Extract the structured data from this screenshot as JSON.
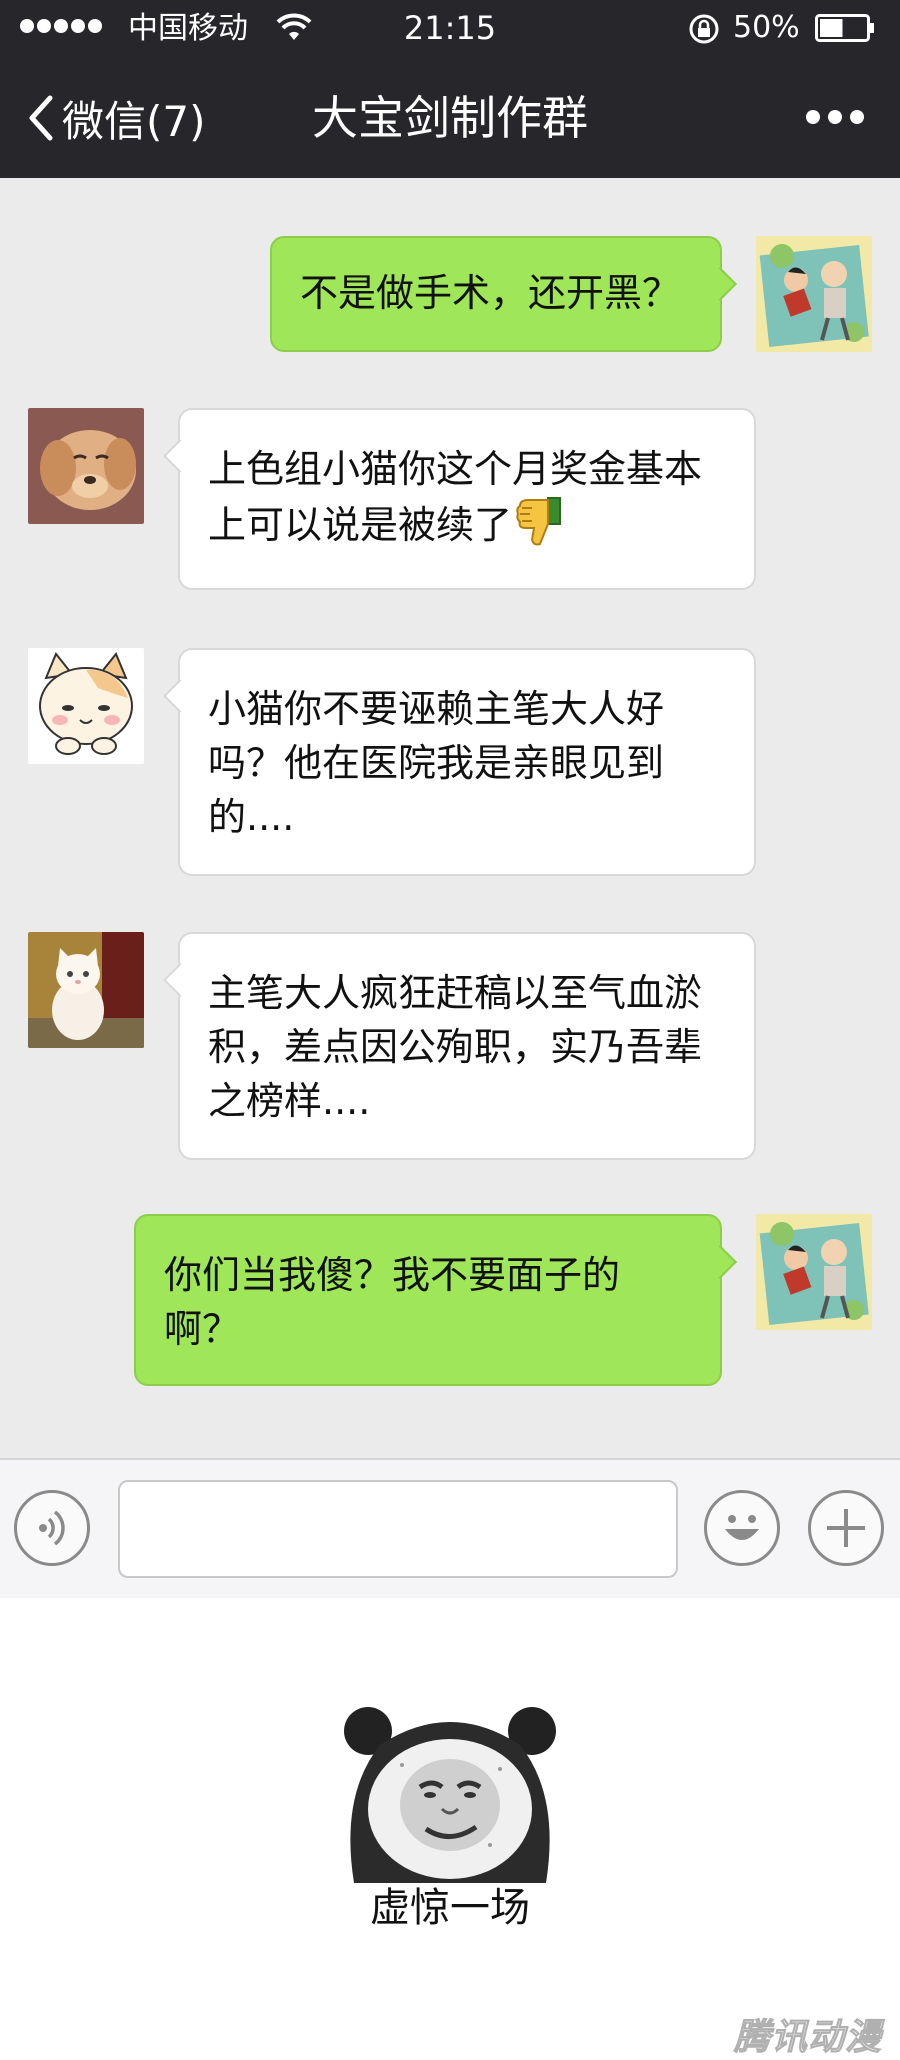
{
  "status_bar": {
    "carrier": "中国移动",
    "time": "21:15",
    "battery": "50%",
    "battery_level": 0.5
  },
  "nav": {
    "back_label": "微信(7)",
    "title": "大宝剑制作群"
  },
  "messages": [
    {
      "side": "out",
      "text": "不是做手术，还开黑？"
    },
    {
      "side": "in",
      "text": "上色组小猫你这个月奖金基本上可以说是被续了",
      "emoji": "thumbs-down-icon"
    },
    {
      "side": "in",
      "text": "小猫你不要诬赖主笔大人好吗？他在医院我是亲眼见到的...."
    },
    {
      "side": "in",
      "text": "主笔大人疯狂赶稿以至气血淤积，差点因公殉职，实乃吾辈之榜样...."
    },
    {
      "side": "out",
      "text": "你们当我傻？我不要面子的啊？"
    }
  ],
  "input_bar": {
    "voice_icon": "voice-icon",
    "emoji_icon": "smiley-icon",
    "add_icon": "plus-icon"
  },
  "panel": {
    "caption": "虚惊一场",
    "watermark": "腾讯动漫"
  },
  "colors": {
    "header": "#26262b",
    "chat_bg": "#ebebeb",
    "out_bubble": "#9fe658",
    "in_bubble": "#ffffff"
  }
}
